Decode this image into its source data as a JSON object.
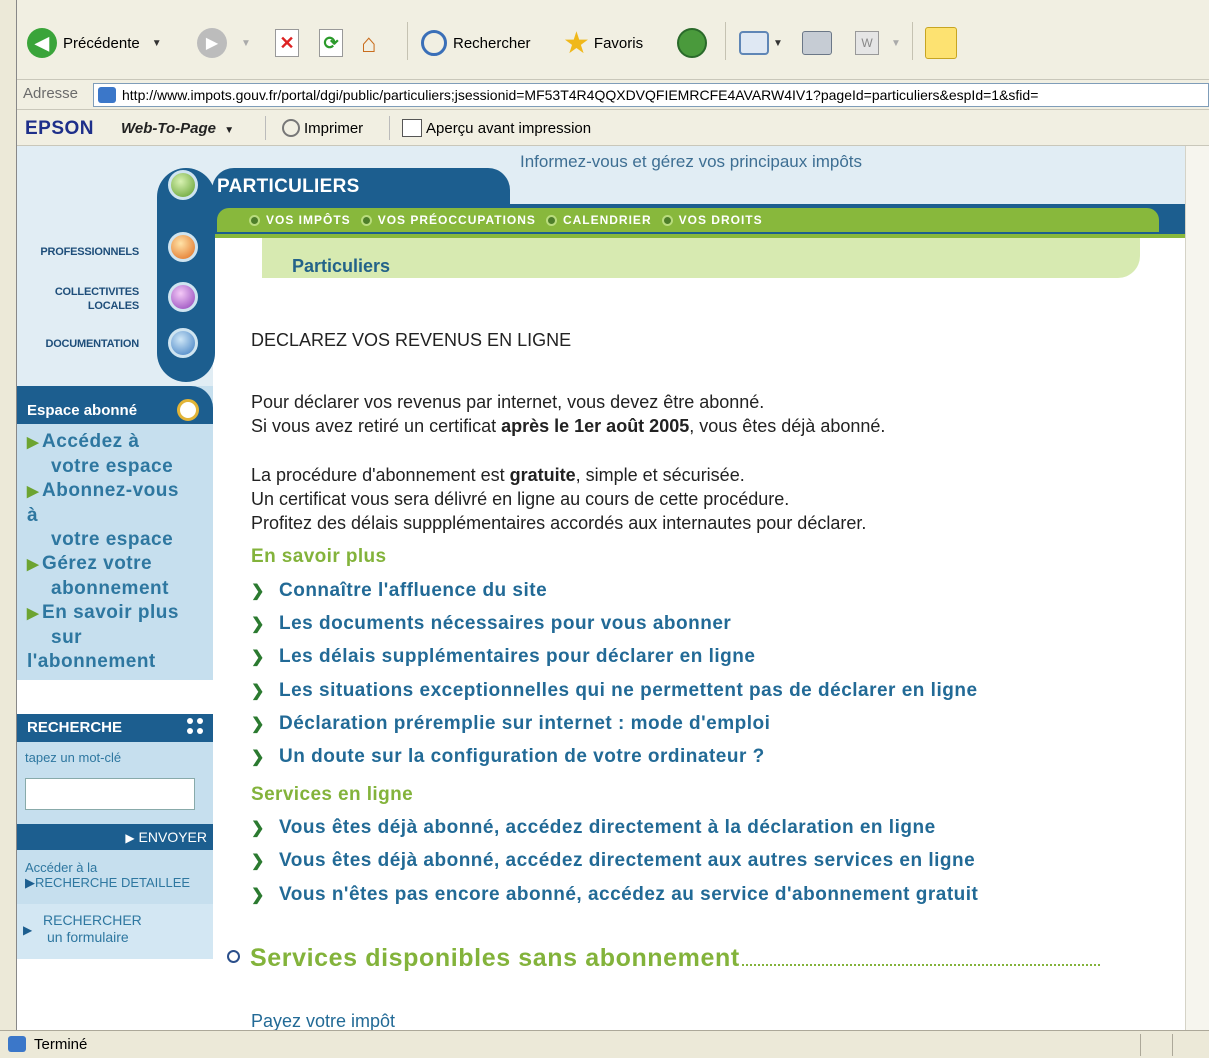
{
  "toolbar": {
    "back_label": "Précédente",
    "search_label": "Rechercher",
    "favorites_label": "Favoris"
  },
  "address": {
    "label": "Adresse",
    "url": "http://www.impots.gouv.fr/portal/dgi/public/particuliers;jsessionid=MF53T4R4QQXDVQFIEMRCFE4AVARW4IV1?pageId=particuliers&espId=1&sfid="
  },
  "epson": {
    "brand": "EPSON",
    "webtopage": "Web-To-Page",
    "print_label": "Imprimer",
    "preview_label": "Aperçu avant impression"
  },
  "site": {
    "tagline": "Informez-vous et gérez vos principaux impôts",
    "section_title": "PARTICULIERS",
    "nav": [
      "VOS IMPÔTS",
      "VOS PRÉOCCUPATIONS",
      "CALENDRIER",
      "VOS DROITS"
    ],
    "breadcrumb": "Particuliers",
    "rail": [
      "PROFESSIONNELS",
      "COLLECTIVITES",
      "LOCALES",
      "DOCUMENTATION"
    ]
  },
  "espace": {
    "title": "Espace abonné",
    "links": [
      {
        "l1": "Accédez à",
        "l2": "votre espace"
      },
      {
        "l1": "Abonnez-vous",
        "l2": "à",
        "l3": "votre espace"
      },
      {
        "l1": "Gérez votre",
        "l2": "abonnement"
      },
      {
        "l1": "En savoir plus",
        "l2": "sur",
        "l3": "l'abonnement"
      }
    ]
  },
  "recherche": {
    "title": "RECHERCHE",
    "hint": "tapez un mot-clé",
    "input_value": "",
    "submit": "ENVOYER",
    "detail_pre": "Accéder à la",
    "detail": "RECHERCHE DETAILLEE",
    "form_l1": "RECHERCHER",
    "form_l2": "un formulaire"
  },
  "main": {
    "heading": "DECLAREZ VOS REVENUS EN LIGNE",
    "p1_l1": "Pour déclarer vos revenus par internet, vous devez être abonné.",
    "p1_l2a": "Si vous avez retiré un certificat ",
    "p1_l2b": "après le 1er août 2005",
    "p1_l2c": ", vous êtes déjà abonné.",
    "p2_l1a": "La procédure d'abonnement est ",
    "p2_l1b": "gratuite",
    "p2_l1c": ", simple et sécurisée.",
    "p2_l2": "Un certificat vous sera délivré en ligne au cours de cette procédure.",
    "p2_l3": "Profitez des délais suppplémentaires accordés aux internautes pour déclarer.",
    "savoir_title": "En savoir plus",
    "savoir_links": [
      "Connaître l'affluence du site",
      "Les documents nécessaires pour vous abonner",
      "Les délais supplémentaires pour déclarer en ligne",
      "Les situations exceptionnelles qui ne permettent pas de déclarer en ligne",
      "Déclaration préremplie sur internet : mode d'emploi",
      "Un doute sur la configuration de votre ordinateur ?"
    ],
    "services_title": "Services en ligne",
    "services_links": [
      "Vous êtes déjà abonné, accédez directement à la déclaration en ligne",
      "Vous êtes déjà abonné, accédez directement aux autres services en ligne",
      "Vous n'êtes pas encore abonné, accédez au service d'abonnement gratuit"
    ],
    "dispo_title": "Services disponibles sans abonnement",
    "payez": "Payez votre impôt"
  },
  "status": {
    "text": "Terminé"
  }
}
